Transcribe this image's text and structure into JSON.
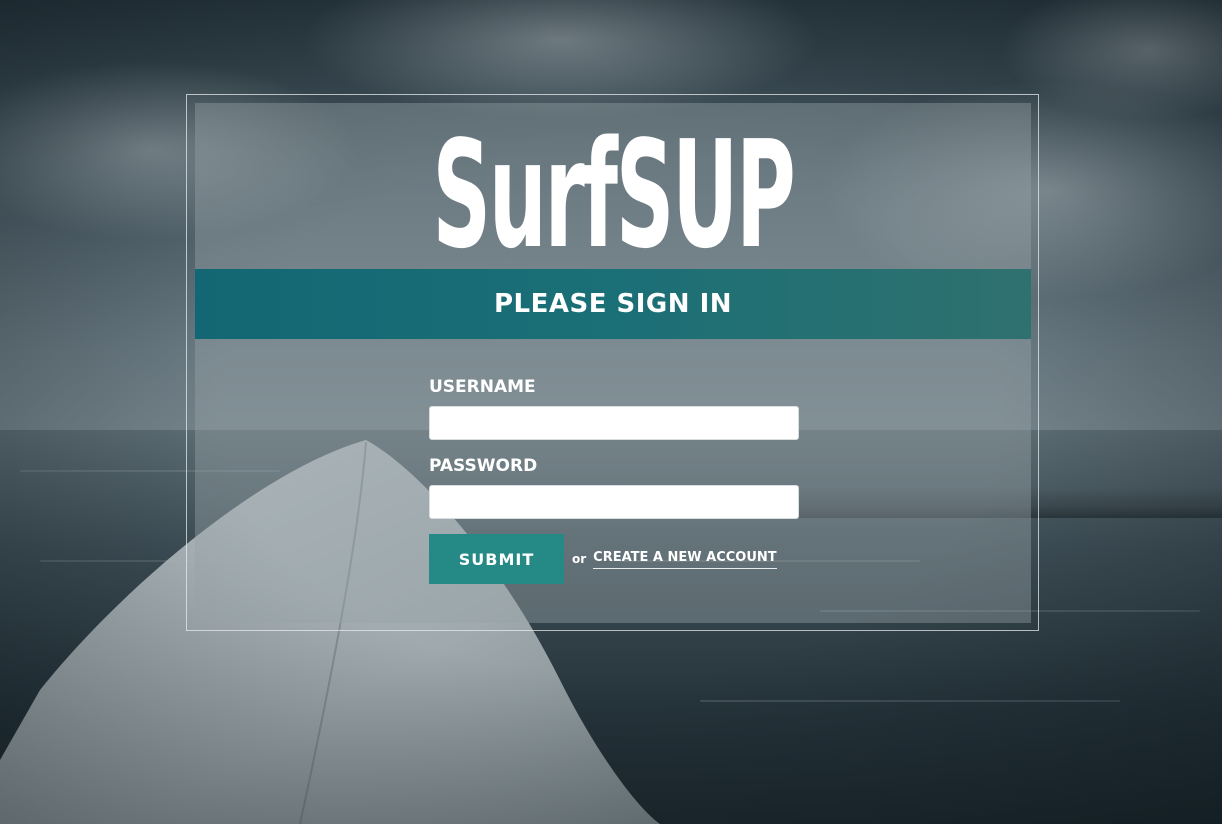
{
  "app": {
    "logo_text": "SurfSUP"
  },
  "banner": {
    "title": "PLEASE SIGN IN"
  },
  "form": {
    "username_label": "USERNAME",
    "username_value": "",
    "password_label": "PASSWORD",
    "password_value": "",
    "submit_label": "SUBMIT",
    "or_text": "or",
    "create_account_label": "CREATE A NEW ACCOUNT"
  },
  "colors": {
    "banner": "#136774",
    "submit_button": "#258a85",
    "text": "#ffffff"
  }
}
